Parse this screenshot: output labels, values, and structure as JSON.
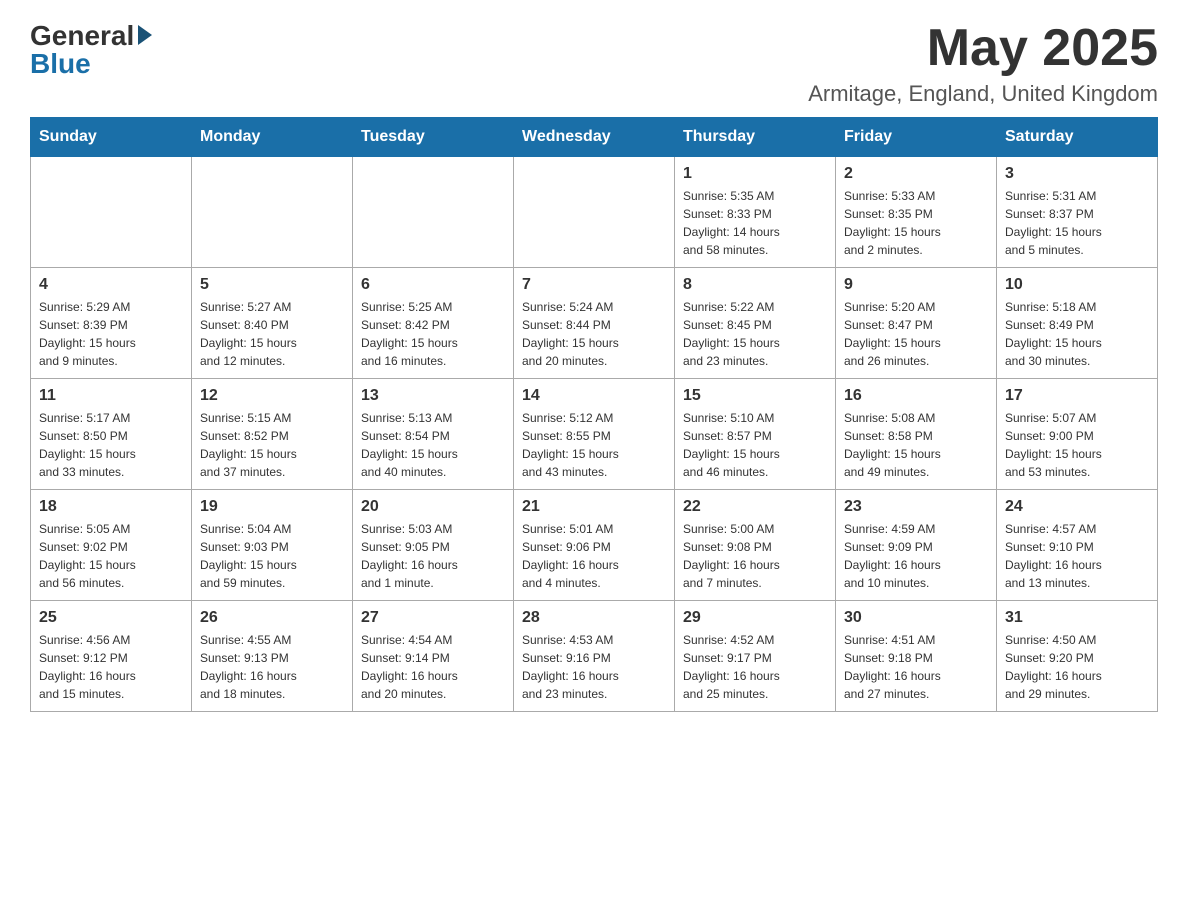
{
  "header": {
    "logo_general": "General",
    "logo_blue": "Blue",
    "month_title": "May 2025",
    "location": "Armitage, England, United Kingdom"
  },
  "weekdays": [
    "Sunday",
    "Monday",
    "Tuesday",
    "Wednesday",
    "Thursday",
    "Friday",
    "Saturday"
  ],
  "weeks": [
    [
      {
        "day": "",
        "info": ""
      },
      {
        "day": "",
        "info": ""
      },
      {
        "day": "",
        "info": ""
      },
      {
        "day": "",
        "info": ""
      },
      {
        "day": "1",
        "info": "Sunrise: 5:35 AM\nSunset: 8:33 PM\nDaylight: 14 hours\nand 58 minutes."
      },
      {
        "day": "2",
        "info": "Sunrise: 5:33 AM\nSunset: 8:35 PM\nDaylight: 15 hours\nand 2 minutes."
      },
      {
        "day": "3",
        "info": "Sunrise: 5:31 AM\nSunset: 8:37 PM\nDaylight: 15 hours\nand 5 minutes."
      }
    ],
    [
      {
        "day": "4",
        "info": "Sunrise: 5:29 AM\nSunset: 8:39 PM\nDaylight: 15 hours\nand 9 minutes."
      },
      {
        "day": "5",
        "info": "Sunrise: 5:27 AM\nSunset: 8:40 PM\nDaylight: 15 hours\nand 12 minutes."
      },
      {
        "day": "6",
        "info": "Sunrise: 5:25 AM\nSunset: 8:42 PM\nDaylight: 15 hours\nand 16 minutes."
      },
      {
        "day": "7",
        "info": "Sunrise: 5:24 AM\nSunset: 8:44 PM\nDaylight: 15 hours\nand 20 minutes."
      },
      {
        "day": "8",
        "info": "Sunrise: 5:22 AM\nSunset: 8:45 PM\nDaylight: 15 hours\nand 23 minutes."
      },
      {
        "day": "9",
        "info": "Sunrise: 5:20 AM\nSunset: 8:47 PM\nDaylight: 15 hours\nand 26 minutes."
      },
      {
        "day": "10",
        "info": "Sunrise: 5:18 AM\nSunset: 8:49 PM\nDaylight: 15 hours\nand 30 minutes."
      }
    ],
    [
      {
        "day": "11",
        "info": "Sunrise: 5:17 AM\nSunset: 8:50 PM\nDaylight: 15 hours\nand 33 minutes."
      },
      {
        "day": "12",
        "info": "Sunrise: 5:15 AM\nSunset: 8:52 PM\nDaylight: 15 hours\nand 37 minutes."
      },
      {
        "day": "13",
        "info": "Sunrise: 5:13 AM\nSunset: 8:54 PM\nDaylight: 15 hours\nand 40 minutes."
      },
      {
        "day": "14",
        "info": "Sunrise: 5:12 AM\nSunset: 8:55 PM\nDaylight: 15 hours\nand 43 minutes."
      },
      {
        "day": "15",
        "info": "Sunrise: 5:10 AM\nSunset: 8:57 PM\nDaylight: 15 hours\nand 46 minutes."
      },
      {
        "day": "16",
        "info": "Sunrise: 5:08 AM\nSunset: 8:58 PM\nDaylight: 15 hours\nand 49 minutes."
      },
      {
        "day": "17",
        "info": "Sunrise: 5:07 AM\nSunset: 9:00 PM\nDaylight: 15 hours\nand 53 minutes."
      }
    ],
    [
      {
        "day": "18",
        "info": "Sunrise: 5:05 AM\nSunset: 9:02 PM\nDaylight: 15 hours\nand 56 minutes."
      },
      {
        "day": "19",
        "info": "Sunrise: 5:04 AM\nSunset: 9:03 PM\nDaylight: 15 hours\nand 59 minutes."
      },
      {
        "day": "20",
        "info": "Sunrise: 5:03 AM\nSunset: 9:05 PM\nDaylight: 16 hours\nand 1 minute."
      },
      {
        "day": "21",
        "info": "Sunrise: 5:01 AM\nSunset: 9:06 PM\nDaylight: 16 hours\nand 4 minutes."
      },
      {
        "day": "22",
        "info": "Sunrise: 5:00 AM\nSunset: 9:08 PM\nDaylight: 16 hours\nand 7 minutes."
      },
      {
        "day": "23",
        "info": "Sunrise: 4:59 AM\nSunset: 9:09 PM\nDaylight: 16 hours\nand 10 minutes."
      },
      {
        "day": "24",
        "info": "Sunrise: 4:57 AM\nSunset: 9:10 PM\nDaylight: 16 hours\nand 13 minutes."
      }
    ],
    [
      {
        "day": "25",
        "info": "Sunrise: 4:56 AM\nSunset: 9:12 PM\nDaylight: 16 hours\nand 15 minutes."
      },
      {
        "day": "26",
        "info": "Sunrise: 4:55 AM\nSunset: 9:13 PM\nDaylight: 16 hours\nand 18 minutes."
      },
      {
        "day": "27",
        "info": "Sunrise: 4:54 AM\nSunset: 9:14 PM\nDaylight: 16 hours\nand 20 minutes."
      },
      {
        "day": "28",
        "info": "Sunrise: 4:53 AM\nSunset: 9:16 PM\nDaylight: 16 hours\nand 23 minutes."
      },
      {
        "day": "29",
        "info": "Sunrise: 4:52 AM\nSunset: 9:17 PM\nDaylight: 16 hours\nand 25 minutes."
      },
      {
        "day": "30",
        "info": "Sunrise: 4:51 AM\nSunset: 9:18 PM\nDaylight: 16 hours\nand 27 minutes."
      },
      {
        "day": "31",
        "info": "Sunrise: 4:50 AM\nSunset: 9:20 PM\nDaylight: 16 hours\nand 29 minutes."
      }
    ]
  ]
}
